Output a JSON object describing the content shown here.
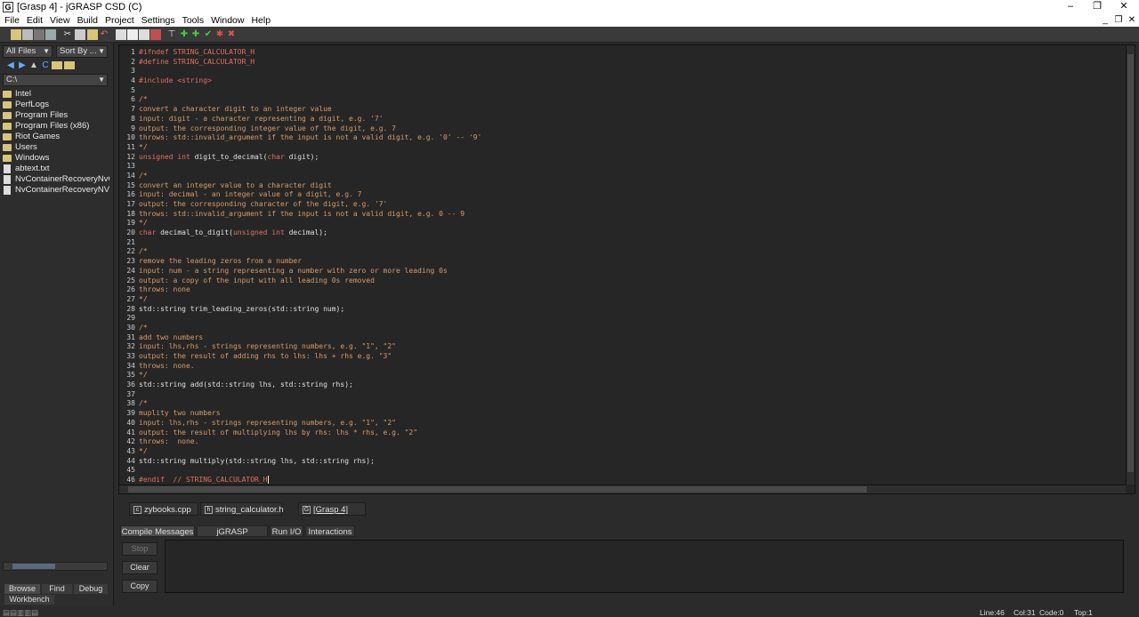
{
  "window": {
    "title": "[Grasp 4] - jGRASP CSD (C)",
    "minimize": "–",
    "restore": "❐",
    "close": "✕"
  },
  "menu": [
    "File",
    "Edit",
    "View",
    "Build",
    "Project",
    "Settings",
    "Tools",
    "Window",
    "Help"
  ],
  "browser": {
    "filter_label": "All Files",
    "sort_label": "Sort By ...",
    "path": "C:\\",
    "items": [
      {
        "name": "Intel",
        "type": "folder"
      },
      {
        "name": "PerfLogs",
        "type": "folder"
      },
      {
        "name": "Program Files",
        "type": "folder"
      },
      {
        "name": "Program Files (x86)",
        "type": "folder"
      },
      {
        "name": "Riot Games",
        "type": "folder"
      },
      {
        "name": "Users",
        "type": "folder"
      },
      {
        "name": "Windows",
        "type": "folder"
      },
      {
        "name": "abtext.txt",
        "type": "file"
      },
      {
        "name": "NvContainerRecoveryNvContai",
        "type": "file"
      },
      {
        "name": "NvContainerRecoveryNVDispla",
        "type": "file"
      }
    ],
    "tabs": {
      "browse": "Browse",
      "find": "Find",
      "debug": "Debug",
      "workbench": "Workbench"
    }
  },
  "editor": {
    "lines": [
      [
        [
          "pp",
          "#ifndef STRING_CALCULATOR_H"
        ]
      ],
      [
        [
          "pp",
          "#define STRING_CALCULATOR_H"
        ]
      ],
      [],
      [
        [
          "pp",
          "#include <string>"
        ]
      ],
      [],
      [
        [
          "cm",
          "/*"
        ]
      ],
      [
        [
          "cm",
          "convert a character digit to an integer value"
        ]
      ],
      [
        [
          "cm",
          "input: digit - a character representing a digit, e.g. '7'"
        ]
      ],
      [
        [
          "cm",
          "output: the corresponding integer value of the digit, e.g. 7"
        ]
      ],
      [
        [
          "cm",
          "throws: std::invalid_argument if the input is not a valid digit, e.g. '0' -- '9'"
        ]
      ],
      [
        [
          "cm",
          "*/"
        ]
      ],
      [
        [
          "kw",
          "unsigned int"
        ],
        [
          "",
          " digit_to_decimal("
        ],
        [
          "kw",
          "char"
        ],
        [
          "",
          " digit);"
        ]
      ],
      [],
      [
        [
          "cm",
          "/*"
        ]
      ],
      [
        [
          "cm",
          "convert an integer value to a character digit"
        ]
      ],
      [
        [
          "cm",
          "input: decimal - an integer value of a digit, e.g. 7"
        ]
      ],
      [
        [
          "cm",
          "output: the corresponding character of the digit, e.g. '7'"
        ]
      ],
      [
        [
          "cm",
          "throws: std::invalid_argument if the input is not a valid digit, e.g. 0 -- 9"
        ]
      ],
      [
        [
          "cm",
          "*/"
        ]
      ],
      [
        [
          "kw",
          "char"
        ],
        [
          "",
          " decimal_to_digit("
        ],
        [
          "kw",
          "unsigned int"
        ],
        [
          "",
          " decimal);"
        ]
      ],
      [],
      [
        [
          "cm",
          "/*"
        ]
      ],
      [
        [
          "cm",
          "remove the leading zeros from a number"
        ]
      ],
      [
        [
          "cm",
          "input: num - a string representing a number with zero or more leading 0s"
        ]
      ],
      [
        [
          "cm",
          "output: a copy of the input with all leading 0s removed"
        ]
      ],
      [
        [
          "cm",
          "throws: none"
        ]
      ],
      [
        [
          "cm",
          "*/"
        ]
      ],
      [
        [
          "",
          "std::string trim_leading_zeros(std::string num);"
        ]
      ],
      [],
      [
        [
          "cm",
          "/*"
        ]
      ],
      [
        [
          "cm",
          "add two numbers"
        ]
      ],
      [
        [
          "cm",
          "input: lhs,rhs - strings representing numbers, e.g. \"1\", \"2\""
        ]
      ],
      [
        [
          "cm",
          "output: the result of adding rhs to lhs: lhs + rhs e.g. \"3\""
        ]
      ],
      [
        [
          "cm",
          "throws: none."
        ]
      ],
      [
        [
          "cm",
          "*/"
        ]
      ],
      [
        [
          "",
          "std::string add(std::string lhs, std::string rhs);"
        ]
      ],
      [],
      [
        [
          "cm",
          "/*"
        ]
      ],
      [
        [
          "cm",
          "muplity two numbers"
        ]
      ],
      [
        [
          "cm",
          "input: lhs,rhs - strings representing numbers, e.g. \"1\", \"2\""
        ]
      ],
      [
        [
          "cm",
          "output: the result of multiplying lhs by rhs: lhs * rhs, e.g. \"2\""
        ]
      ],
      [
        [
          "cm",
          "throws:  none."
        ]
      ],
      [
        [
          "cm",
          "*/"
        ]
      ],
      [
        [
          "",
          "std::string multiply(std::string lhs, std::string rhs);"
        ]
      ],
      [],
      [
        [
          "pp",
          "#endif  // STRING_CALCULATOR_H"
        ]
      ]
    ]
  },
  "doc_tabs": [
    "zybooks.cpp",
    "string_calculator.h",
    "[Grasp 4]"
  ],
  "messages": {
    "tabs": [
      "Compile Messages",
      "jGRASP Messages",
      "Run I/O",
      "Interactions"
    ],
    "buttons": {
      "stop": "Stop",
      "clear": "Clear",
      "copy": "Copy"
    }
  },
  "status": {
    "line": "Line:46",
    "col": "Col:31",
    "code": "Code:0",
    "top": "Top:1"
  },
  "colors": {
    "preprocessor": "#e07060",
    "comment": "#d89b6a",
    "keyword": "#e07060",
    "background": "#262626"
  }
}
